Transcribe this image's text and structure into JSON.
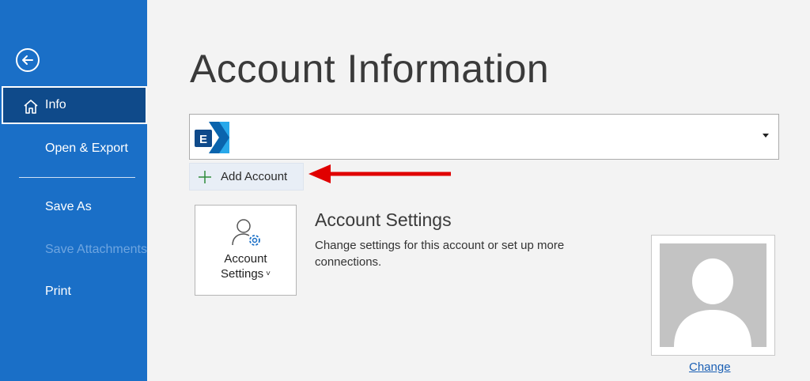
{
  "sidebar": {
    "back_icon": "arrow-left-circle-icon",
    "items": [
      {
        "label": "Info",
        "icon": "home-icon",
        "active": true
      },
      {
        "label": "Open & Export"
      },
      {
        "label": "Save As"
      },
      {
        "label": "Save Attachments",
        "disabled": true
      },
      {
        "label": "Print"
      }
    ]
  },
  "main": {
    "title": "Account Information",
    "account_selector": {
      "icon": "exchange-icon"
    },
    "add_account": {
      "label": "Add Account",
      "icon": "plus-icon"
    },
    "account_settings": {
      "button_line1": "Account",
      "button_line2": "Settings",
      "chevron": "˅",
      "heading": "Account Settings",
      "description": "Change settings for this account or set up more connections."
    },
    "profile": {
      "change_label": "Change"
    }
  },
  "colors": {
    "sidebar_bg": "#1a6fc7",
    "sidebar_active": "#0f4a8a",
    "annotation_arrow": "#e00000",
    "link": "#1a5fb4"
  }
}
